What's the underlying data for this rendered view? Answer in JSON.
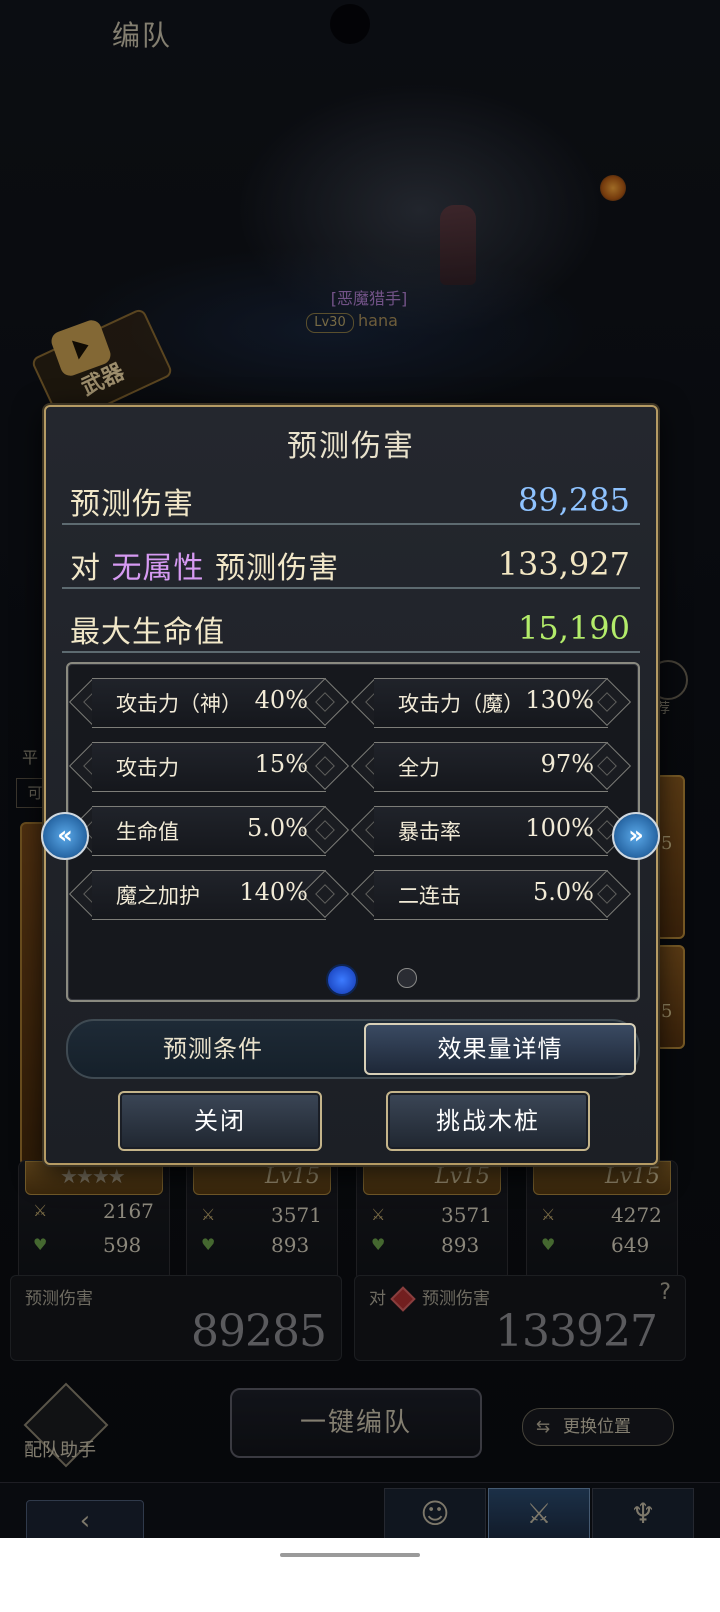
{
  "header": {
    "title": "编队"
  },
  "scene": {
    "job_label": "[恶魔猎手]",
    "level_badge": "Lv30",
    "player_name": "hana"
  },
  "weapon_badge": {
    "label": "武器"
  },
  "side": {
    "left_text": "平",
    "left_chip": "可",
    "right_text": "荐"
  },
  "modal": {
    "title": "预测伤害",
    "summary": [
      {
        "label": "预测伤害",
        "value": "89,285",
        "color": "#8fc3ff"
      },
      {
        "prefix": "对",
        "attribute": "无属性",
        "label": "预测伤害",
        "value": "133,927",
        "color": "#f2e6c2"
      },
      {
        "label": "最大生命值",
        "value": "15,190",
        "color": "#b3ec6a"
      }
    ],
    "stats": [
      {
        "name": "攻击力（神）",
        "value": "40%"
      },
      {
        "name": "攻击力（魔）",
        "value": "130%"
      },
      {
        "name": "攻击力",
        "value": "15%"
      },
      {
        "name": "全力",
        "value": "97%"
      },
      {
        "name": "生命值",
        "value": "5.0%"
      },
      {
        "name": "暴击率",
        "value": "100%"
      },
      {
        "name": "魔之加护",
        "value": "140%"
      },
      {
        "name": "二连击",
        "value": "5.0%"
      }
    ],
    "pager": {
      "current": 1,
      "total": 2
    },
    "nav": {
      "prev": "«",
      "next": "»"
    },
    "tabs": {
      "left": "预测条件",
      "right": "效果量详情",
      "active": "right"
    },
    "buttons": {
      "close": "关闭",
      "challenge": "挑战木桩"
    }
  },
  "right_cards": {
    "lv": "5"
  },
  "units": [
    {
      "lv": "",
      "stars": "★★★★",
      "atk": "2167",
      "hp": "598"
    },
    {
      "lv": "Lv15",
      "atk": "3571",
      "hp": "893"
    },
    {
      "lv": "Lv15",
      "atk": "3571",
      "hp": "893"
    },
    {
      "lv": "Lv15",
      "atk": "4272",
      "hp": "649"
    }
  ],
  "prediction": {
    "left_label": "预测伤害",
    "left_value": "89285",
    "right_prefix": "对",
    "right_label": "预测伤害",
    "right_value": "133927",
    "help": "?"
  },
  "bottom": {
    "assist_label": "配队助手",
    "onekey_label": "一键编队",
    "swap_label": "更换位置",
    "swap_icon": "⇆"
  }
}
